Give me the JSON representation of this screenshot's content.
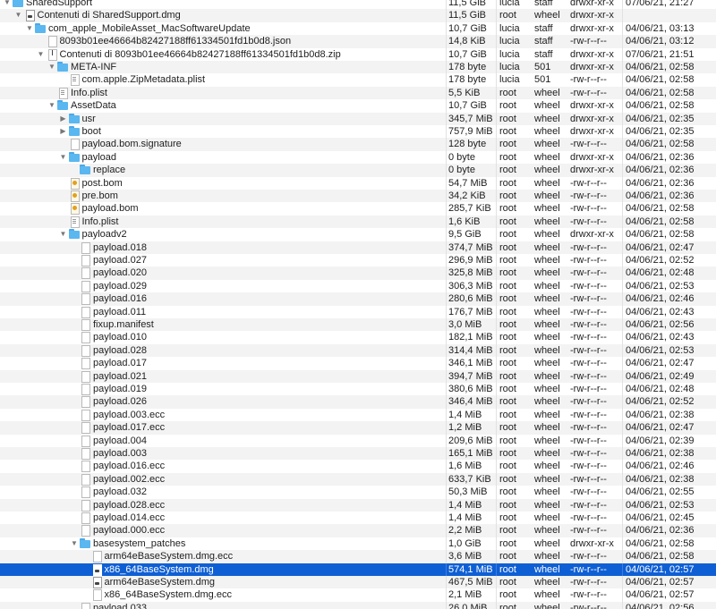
{
  "window": {
    "title": "SharedSupport"
  },
  "rows": [
    {
      "name": "SharedSupport",
      "size": "11,5 GiB",
      "owner": "lucia",
      "group": "staff",
      "perms": "drwxr-xr-x",
      "date": "07/06/21, 21:27",
      "depth": 0,
      "icon": "folder-icon",
      "toggle": "expanded"
    },
    {
      "name": "Contenuti di SharedSupport.dmg",
      "size": "11,5 GiB",
      "owner": "root",
      "group": "wheel",
      "perms": "drwxr-xr-x",
      "date": "",
      "depth": 1,
      "icon": "dmg-icon",
      "toggle": "expanded"
    },
    {
      "name": "com_apple_MobileAsset_MacSoftwareUpdate",
      "size": "10,7 GiB",
      "owner": "lucia",
      "group": "staff",
      "perms": "drwxr-xr-x",
      "date": "04/06/21, 03:13",
      "depth": 2,
      "icon": "folder-icon",
      "toggle": "expanded"
    },
    {
      "name": "8093b01ee46664b82427188ff61334501fd1b0d8.json",
      "size": "14,8 KiB",
      "owner": "lucia",
      "group": "staff",
      "perms": "-rw-r--r--",
      "date": "04/06/21, 03:12",
      "depth": 3,
      "icon": "file-icon",
      "toggle": "none"
    },
    {
      "name": "Contenuti di 8093b01ee46664b82427188ff61334501fd1b0d8.zip",
      "size": "10,7 GiB",
      "owner": "lucia",
      "group": "staff",
      "perms": "drwxr-xr-x",
      "date": "07/06/21, 21:51",
      "depth": 3,
      "icon": "zip-icon",
      "toggle": "expanded"
    },
    {
      "name": "META-INF",
      "size": "178 byte",
      "owner": "lucia",
      "group": "501",
      "perms": "drwxr-xr-x",
      "date": "04/06/21, 02:58",
      "depth": 4,
      "icon": "folder-icon",
      "toggle": "expanded"
    },
    {
      "name": "com.apple.ZipMetadata.plist",
      "size": "178 byte",
      "owner": "lucia",
      "group": "501",
      "perms": "-rw-r--r--",
      "date": "04/06/21, 02:58",
      "depth": 5,
      "icon": "plist-icon",
      "toggle": "none"
    },
    {
      "name": "Info.plist",
      "size": "5,5 KiB",
      "owner": "root",
      "group": "wheel",
      "perms": "-rw-r--r--",
      "date": "04/06/21, 02:58",
      "depth": 4,
      "icon": "plist-icon",
      "toggle": "none"
    },
    {
      "name": "AssetData",
      "size": "10,7 GiB",
      "owner": "root",
      "group": "wheel",
      "perms": "drwxr-xr-x",
      "date": "04/06/21, 02:58",
      "depth": 4,
      "icon": "folder-icon",
      "toggle": "expanded"
    },
    {
      "name": "usr",
      "size": "345,7 MiB",
      "owner": "root",
      "group": "wheel",
      "perms": "drwxr-xr-x",
      "date": "04/06/21, 02:35",
      "depth": 5,
      "icon": "folder-icon",
      "toggle": "collapsed"
    },
    {
      "name": "boot",
      "size": "757,9 MiB",
      "owner": "root",
      "group": "wheel",
      "perms": "drwxr-xr-x",
      "date": "04/06/21, 02:35",
      "depth": 5,
      "icon": "folder-icon",
      "toggle": "collapsed"
    },
    {
      "name": "payload.bom.signature",
      "size": "128 byte",
      "owner": "root",
      "group": "wheel",
      "perms": "-rw-r--r--",
      "date": "04/06/21, 02:58",
      "depth": 5,
      "icon": "file-icon",
      "toggle": "none"
    },
    {
      "name": "payload",
      "size": "0 byte",
      "owner": "root",
      "group": "wheel",
      "perms": "drwxr-xr-x",
      "date": "04/06/21, 02:36",
      "depth": 5,
      "icon": "folder-icon",
      "toggle": "expanded"
    },
    {
      "name": "replace",
      "size": "0 byte",
      "owner": "root",
      "group": "wheel",
      "perms": "drwxr-xr-x",
      "date": "04/06/21, 02:36",
      "depth": 6,
      "icon": "folder-icon",
      "toggle": "none"
    },
    {
      "name": "post.bom",
      "size": "54,7 MiB",
      "owner": "root",
      "group": "wheel",
      "perms": "-rw-r--r--",
      "date": "04/06/21, 02:36",
      "depth": 5,
      "icon": "bom-icon",
      "toggle": "none"
    },
    {
      "name": "pre.bom",
      "size": "34,2 KiB",
      "owner": "root",
      "group": "wheel",
      "perms": "-rw-r--r--",
      "date": "04/06/21, 02:36",
      "depth": 5,
      "icon": "bom-icon",
      "toggle": "none"
    },
    {
      "name": "payload.bom",
      "size": "285,7 KiB",
      "owner": "root",
      "group": "wheel",
      "perms": "-rw-r--r--",
      "date": "04/06/21, 02:58",
      "depth": 5,
      "icon": "bom-icon",
      "toggle": "none"
    },
    {
      "name": "Info.plist",
      "size": "1,6 KiB",
      "owner": "root",
      "group": "wheel",
      "perms": "-rw-r--r--",
      "date": "04/06/21, 02:58",
      "depth": 5,
      "icon": "plist-icon",
      "toggle": "none"
    },
    {
      "name": "payloadv2",
      "size": "9,5 GiB",
      "owner": "root",
      "group": "wheel",
      "perms": "drwxr-xr-x",
      "date": "04/06/21, 02:58",
      "depth": 5,
      "icon": "folder-icon",
      "toggle": "expanded"
    },
    {
      "name": "payload.018",
      "size": "374,7 MiB",
      "owner": "root",
      "group": "wheel",
      "perms": "-rw-r--r--",
      "date": "04/06/21, 02:47",
      "depth": 6,
      "icon": "file-icon",
      "toggle": "none"
    },
    {
      "name": "payload.027",
      "size": "296,9 MiB",
      "owner": "root",
      "group": "wheel",
      "perms": "-rw-r--r--",
      "date": "04/06/21, 02:52",
      "depth": 6,
      "icon": "file-icon",
      "toggle": "none"
    },
    {
      "name": "payload.020",
      "size": "325,8 MiB",
      "owner": "root",
      "group": "wheel",
      "perms": "-rw-r--r--",
      "date": "04/06/21, 02:48",
      "depth": 6,
      "icon": "file-icon",
      "toggle": "none"
    },
    {
      "name": "payload.029",
      "size": "306,3 MiB",
      "owner": "root",
      "group": "wheel",
      "perms": "-rw-r--r--",
      "date": "04/06/21, 02:53",
      "depth": 6,
      "icon": "file-icon",
      "toggle": "none"
    },
    {
      "name": "payload.016",
      "size": "280,6 MiB",
      "owner": "root",
      "group": "wheel",
      "perms": "-rw-r--r--",
      "date": "04/06/21, 02:46",
      "depth": 6,
      "icon": "file-icon",
      "toggle": "none"
    },
    {
      "name": "payload.011",
      "size": "176,7 MiB",
      "owner": "root",
      "group": "wheel",
      "perms": "-rw-r--r--",
      "date": "04/06/21, 02:43",
      "depth": 6,
      "icon": "file-icon",
      "toggle": "none"
    },
    {
      "name": "fixup.manifest",
      "size": "3,0 MiB",
      "owner": "root",
      "group": "wheel",
      "perms": "-rw-r--r--",
      "date": "04/06/21, 02:56",
      "depth": 6,
      "icon": "file-icon",
      "toggle": "none"
    },
    {
      "name": "payload.010",
      "size": "182,1 MiB",
      "owner": "root",
      "group": "wheel",
      "perms": "-rw-r--r--",
      "date": "04/06/21, 02:43",
      "depth": 6,
      "icon": "file-icon",
      "toggle": "none"
    },
    {
      "name": "payload.028",
      "size": "314,4 MiB",
      "owner": "root",
      "group": "wheel",
      "perms": "-rw-r--r--",
      "date": "04/06/21, 02:53",
      "depth": 6,
      "icon": "file-icon",
      "toggle": "none"
    },
    {
      "name": "payload.017",
      "size": "346,1 MiB",
      "owner": "root",
      "group": "wheel",
      "perms": "-rw-r--r--",
      "date": "04/06/21, 02:47",
      "depth": 6,
      "icon": "file-icon",
      "toggle": "none"
    },
    {
      "name": "payload.021",
      "size": "394,7 MiB",
      "owner": "root",
      "group": "wheel",
      "perms": "-rw-r--r--",
      "date": "04/06/21, 02:49",
      "depth": 6,
      "icon": "file-icon",
      "toggle": "none"
    },
    {
      "name": "payload.019",
      "size": "380,6 MiB",
      "owner": "root",
      "group": "wheel",
      "perms": "-rw-r--r--",
      "date": "04/06/21, 02:48",
      "depth": 6,
      "icon": "file-icon",
      "toggle": "none"
    },
    {
      "name": "payload.026",
      "size": "346,4 MiB",
      "owner": "root",
      "group": "wheel",
      "perms": "-rw-r--r--",
      "date": "04/06/21, 02:52",
      "depth": 6,
      "icon": "file-icon",
      "toggle": "none"
    },
    {
      "name": "payload.003.ecc",
      "size": "1,4 MiB",
      "owner": "root",
      "group": "wheel",
      "perms": "-rw-r--r--",
      "date": "04/06/21, 02:38",
      "depth": 6,
      "icon": "file-icon",
      "toggle": "none"
    },
    {
      "name": "payload.017.ecc",
      "size": "1,2 MiB",
      "owner": "root",
      "group": "wheel",
      "perms": "-rw-r--r--",
      "date": "04/06/21, 02:47",
      "depth": 6,
      "icon": "file-icon",
      "toggle": "none"
    },
    {
      "name": "payload.004",
      "size": "209,6 MiB",
      "owner": "root",
      "group": "wheel",
      "perms": "-rw-r--r--",
      "date": "04/06/21, 02:39",
      "depth": 6,
      "icon": "file-icon",
      "toggle": "none"
    },
    {
      "name": "payload.003",
      "size": "165,1 MiB",
      "owner": "root",
      "group": "wheel",
      "perms": "-rw-r--r--",
      "date": "04/06/21, 02:38",
      "depth": 6,
      "icon": "file-icon",
      "toggle": "none"
    },
    {
      "name": "payload.016.ecc",
      "size": "1,6 MiB",
      "owner": "root",
      "group": "wheel",
      "perms": "-rw-r--r--",
      "date": "04/06/21, 02:46",
      "depth": 6,
      "icon": "file-icon",
      "toggle": "none"
    },
    {
      "name": "payload.002.ecc",
      "size": "633,7 KiB",
      "owner": "root",
      "group": "wheel",
      "perms": "-rw-r--r--",
      "date": "04/06/21, 02:38",
      "depth": 6,
      "icon": "file-icon",
      "toggle": "none"
    },
    {
      "name": "payload.032",
      "size": "50,3 MiB",
      "owner": "root",
      "group": "wheel",
      "perms": "-rw-r--r--",
      "date": "04/06/21, 02:55",
      "depth": 6,
      "icon": "file-icon",
      "toggle": "none"
    },
    {
      "name": "payload.028.ecc",
      "size": "1,4 MiB",
      "owner": "root",
      "group": "wheel",
      "perms": "-rw-r--r--",
      "date": "04/06/21, 02:53",
      "depth": 6,
      "icon": "file-icon",
      "toggle": "none"
    },
    {
      "name": "payload.014.ecc",
      "size": "1,4 MiB",
      "owner": "root",
      "group": "wheel",
      "perms": "-rw-r--r--",
      "date": "04/06/21, 02:45",
      "depth": 6,
      "icon": "file-icon",
      "toggle": "none"
    },
    {
      "name": "payload.000.ecc",
      "size": "2,2 MiB",
      "owner": "root",
      "group": "wheel",
      "perms": "-rw-r--r--",
      "date": "04/06/21, 02:36",
      "depth": 6,
      "icon": "file-icon",
      "toggle": "none"
    },
    {
      "name": "basesystem_patches",
      "size": "1,0 GiB",
      "owner": "root",
      "group": "wheel",
      "perms": "drwxr-xr-x",
      "date": "04/06/21, 02:58",
      "depth": 6,
      "icon": "folder-icon",
      "toggle": "expanded"
    },
    {
      "name": "arm64eBaseSystem.dmg.ecc",
      "size": "3,6 MiB",
      "owner": "root",
      "group": "wheel",
      "perms": "-rw-r--r--",
      "date": "04/06/21, 02:58",
      "depth": 7,
      "icon": "file-icon",
      "toggle": "none"
    },
    {
      "name": "x86_64BaseSystem.dmg",
      "size": "574,1 MiB",
      "owner": "root",
      "group": "wheel",
      "perms": "-rw-r--r--",
      "date": "04/06/21, 02:57",
      "depth": 7,
      "icon": "dmg-icon",
      "toggle": "none",
      "selected": true
    },
    {
      "name": "arm64eBaseSystem.dmg",
      "size": "467,5 MiB",
      "owner": "root",
      "group": "wheel",
      "perms": "-rw-r--r--",
      "date": "04/06/21, 02:57",
      "depth": 7,
      "icon": "dmg-icon",
      "toggle": "none"
    },
    {
      "name": "x86_64BaseSystem.dmg.ecc",
      "size": "2,1 MiB",
      "owner": "root",
      "group": "wheel",
      "perms": "-rw-r--r--",
      "date": "04/06/21, 02:57",
      "depth": 7,
      "icon": "file-icon",
      "toggle": "none"
    },
    {
      "name": "payload.033",
      "size": "26,0 MiB",
      "owner": "root",
      "group": "wheel",
      "perms": "-rw-r--r--",
      "date": "04/06/21, 02:56",
      "depth": 6,
      "icon": "file-icon",
      "toggle": "none"
    }
  ]
}
